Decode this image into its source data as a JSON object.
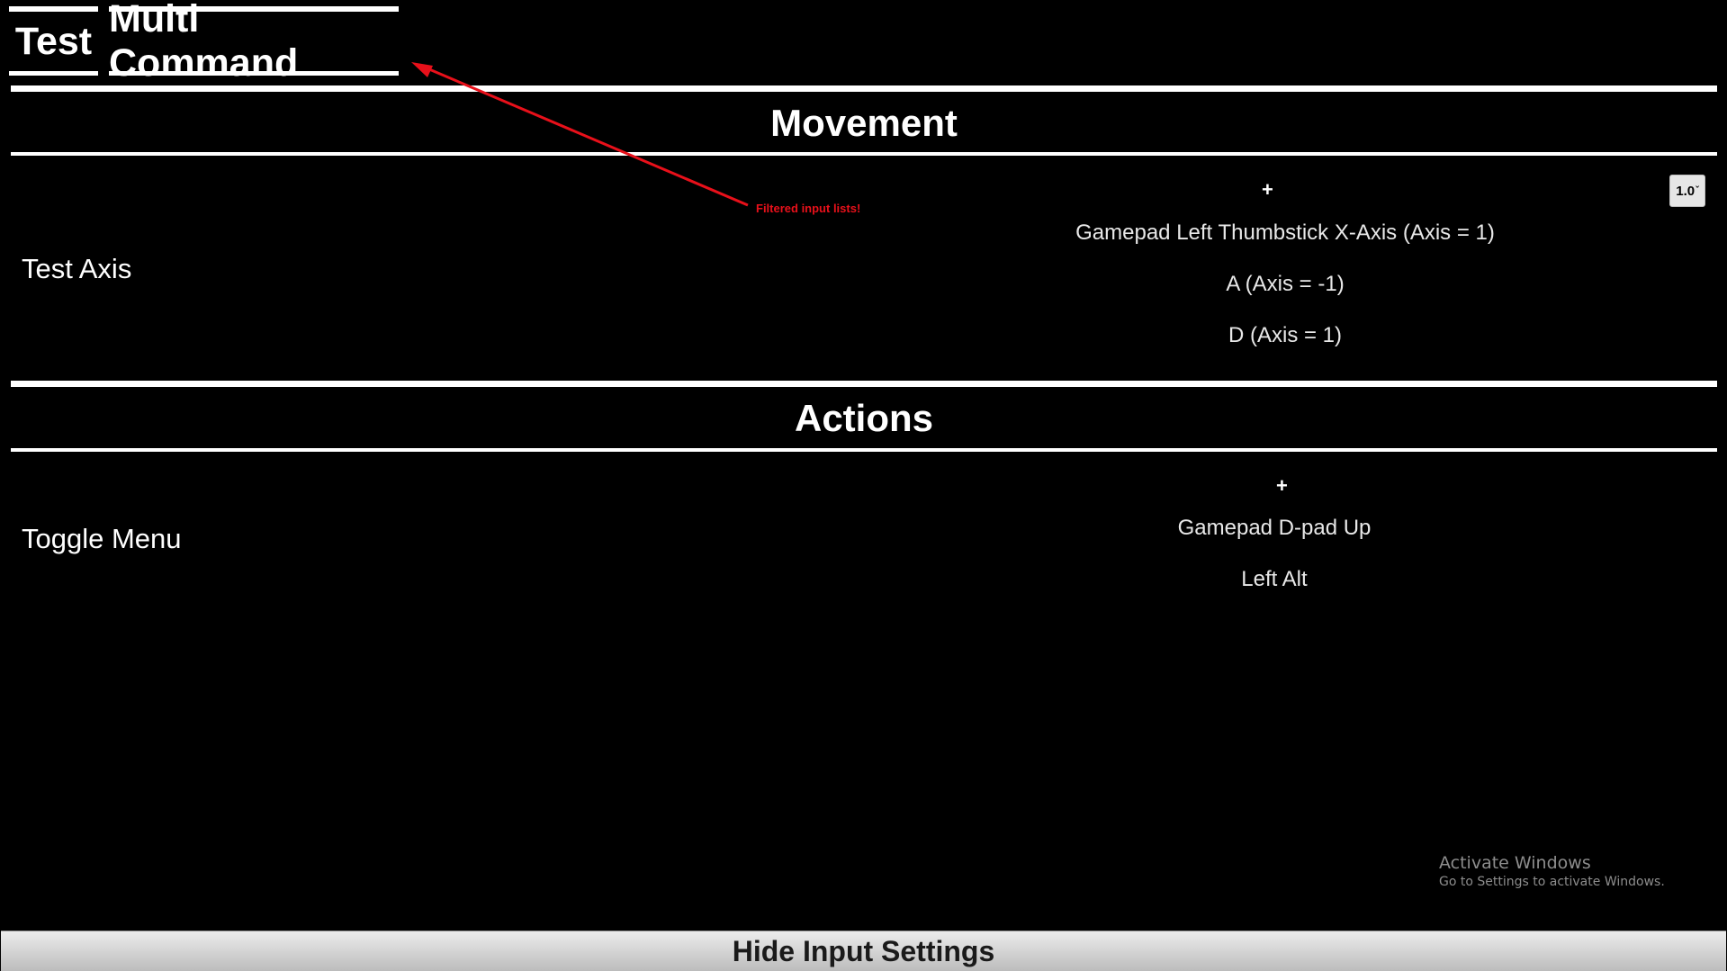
{
  "tabs": [
    {
      "label": "Test"
    },
    {
      "label": "Multi Command"
    }
  ],
  "sections": [
    {
      "title": "Movement",
      "rows": [
        {
          "name": "Test Axis",
          "add_label": "+",
          "bindings": [
            "Gamepad Left Thumbstick X-Axis (Axis = 1)",
            "A (Axis = -1)",
            "D (Axis = 1)"
          ],
          "scale_value": "1.0"
        }
      ]
    },
    {
      "title": "Actions",
      "rows": [
        {
          "name": "Toggle Menu",
          "add_label": "+",
          "bindings": [
            "Gamepad D-pad Up",
            "Left Alt"
          ]
        }
      ]
    }
  ],
  "annotation": {
    "text": "Filtered input lists!",
    "color": "#e8101a"
  },
  "watermark": {
    "title": "Activate Windows",
    "subtitle": "Go to Settings to activate Windows."
  },
  "footer": {
    "toggle_label": "Hide Input Settings"
  },
  "colors": {
    "background": "#000000",
    "foreground": "#ffffff",
    "footer_bar": "#d4d4d4"
  }
}
